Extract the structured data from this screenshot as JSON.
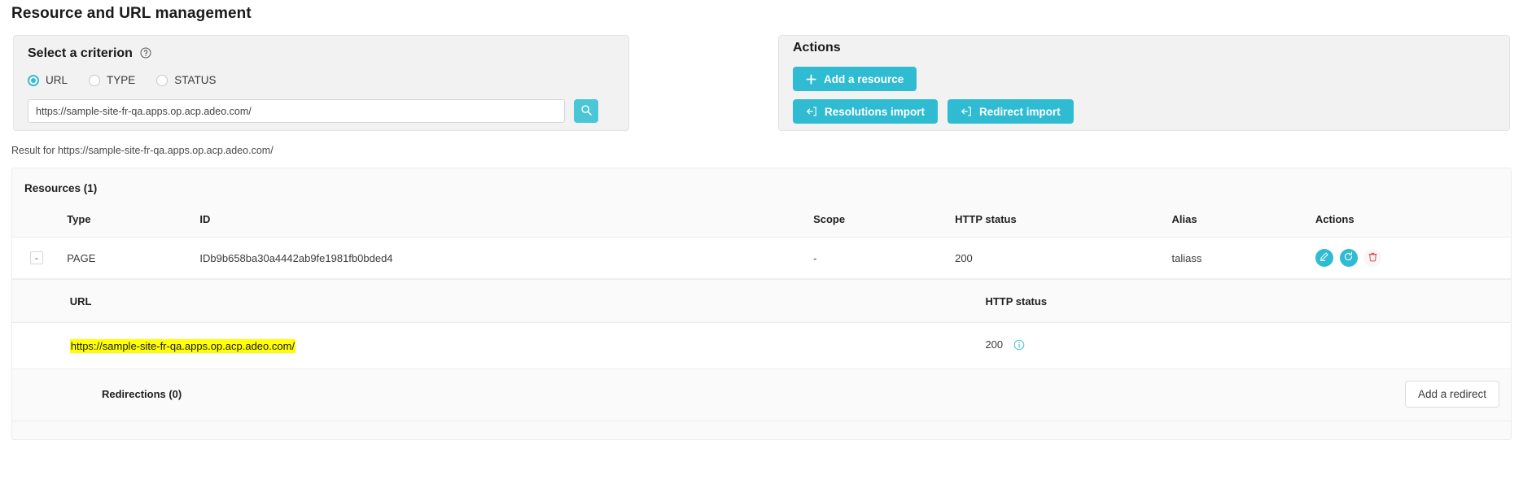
{
  "page": {
    "title": "Resource and URL management"
  },
  "criterion_panel": {
    "heading": "Select a criterion",
    "help_icon": "help-circle-icon",
    "radios": [
      {
        "label": "URL",
        "checked": true
      },
      {
        "label": "TYPE",
        "checked": false
      },
      {
        "label": "STATUS",
        "checked": false
      }
    ],
    "search": {
      "value": "https://sample-site-fr-qa.apps.op.acp.adeo.com/",
      "placeholder": "",
      "button_icon": "search-icon"
    }
  },
  "actions_panel": {
    "heading": "Actions",
    "buttons": [
      {
        "label": "Add a resource",
        "icon": "plus-icon"
      },
      {
        "label": "Resolutions import",
        "icon": "import-icon"
      },
      {
        "label": "Redirect import",
        "icon": "import-icon"
      }
    ]
  },
  "result_line": "Result for https://sample-site-fr-qa.apps.op.acp.adeo.com/",
  "results": {
    "title": "Resources (1)",
    "columns": [
      "Type",
      "ID",
      "Scope",
      "HTTP status",
      "Alias",
      "Actions"
    ],
    "rows": [
      {
        "toggle": "-",
        "type": "PAGE",
        "id": "IDb9b658ba30a4442ab9fe1981fb0bded4",
        "scope": "-",
        "http_status": "200",
        "alias": "taliass",
        "actions": [
          "edit-icon",
          "refresh-icon",
          "delete-icon"
        ]
      }
    ]
  },
  "url_table": {
    "columns": [
      "URL",
      "HTTP status"
    ],
    "rows": [
      {
        "url": "https://sample-site-fr-qa.apps.op.acp.adeo.com/",
        "http_status": "200",
        "info_icon": "info-circle-icon"
      }
    ]
  },
  "redirections": {
    "label": "Redirections (0)",
    "add_button": "Add a redirect"
  },
  "colors": {
    "teal": "#2fbcd2",
    "teal_light": "#4ac6d6",
    "highlight": "#ffff00",
    "danger": "#e8413a",
    "panel_bg": "#f2f2f2",
    "card_bg": "#fafafa"
  }
}
